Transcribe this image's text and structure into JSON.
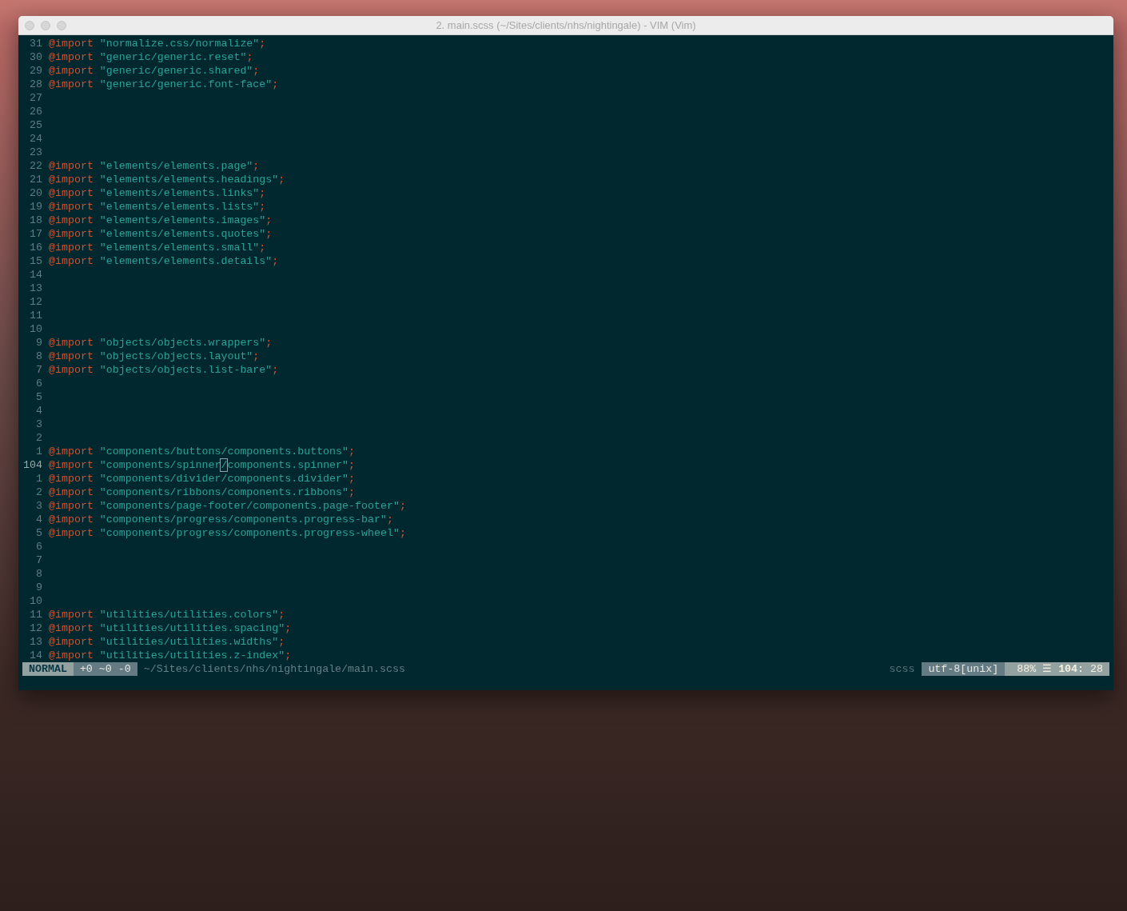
{
  "window": {
    "title": "2. main.scss (~/Sites/clients/nhs/nightingale) - VIM (Vim)"
  },
  "lines": [
    {
      "number": "31",
      "keyword": "@import",
      "string": "\"normalize.css/normalize\"",
      "end": ";",
      "current": false
    },
    {
      "number": "30",
      "keyword": "@import",
      "string": "\"generic/generic.reset\"",
      "end": ";",
      "current": false
    },
    {
      "number": "29",
      "keyword": "@import",
      "string": "\"generic/generic.shared\"",
      "end": ";",
      "current": false
    },
    {
      "number": "28",
      "keyword": "@import",
      "string": "\"generic/generic.font-face\"",
      "end": ";",
      "current": false
    },
    {
      "number": "27",
      "current": false
    },
    {
      "number": "26",
      "current": false
    },
    {
      "number": "25",
      "current": false
    },
    {
      "number": "24",
      "current": false
    },
    {
      "number": "23",
      "current": false
    },
    {
      "number": "22",
      "keyword": "@import",
      "string": "\"elements/elements.page\"",
      "end": ";",
      "current": false
    },
    {
      "number": "21",
      "keyword": "@import",
      "string": "\"elements/elements.headings\"",
      "end": ";",
      "current": false
    },
    {
      "number": "20",
      "keyword": "@import",
      "string": "\"elements/elements.links\"",
      "end": ";",
      "current": false
    },
    {
      "number": "19",
      "keyword": "@import",
      "string": "\"elements/elements.lists\"",
      "end": ";",
      "current": false
    },
    {
      "number": "18",
      "keyword": "@import",
      "string": "\"elements/elements.images\"",
      "end": ";",
      "current": false
    },
    {
      "number": "17",
      "keyword": "@import",
      "string": "\"elements/elements.quotes\"",
      "end": ";",
      "current": false
    },
    {
      "number": "16",
      "keyword": "@import",
      "string": "\"elements/elements.small\"",
      "end": ";",
      "current": false
    },
    {
      "number": "15",
      "keyword": "@import",
      "string": "\"elements/elements.details\"",
      "end": ";",
      "current": false
    },
    {
      "number": "14",
      "current": false
    },
    {
      "number": "13",
      "current": false
    },
    {
      "number": "12",
      "current": false
    },
    {
      "number": "11",
      "current": false
    },
    {
      "number": "10",
      "current": false
    },
    {
      "number": "9",
      "keyword": "@import",
      "string": "\"objects/objects.wrappers\"",
      "end": ";",
      "current": false
    },
    {
      "number": "8",
      "keyword": "@import",
      "string": "\"objects/objects.layout\"",
      "end": ";",
      "current": false
    },
    {
      "number": "7",
      "keyword": "@import",
      "string": "\"objects/objects.list-bare\"",
      "end": ";",
      "current": false
    },
    {
      "number": "6",
      "current": false
    },
    {
      "number": "5",
      "current": false
    },
    {
      "number": "4",
      "current": false
    },
    {
      "number": "3",
      "current": false
    },
    {
      "number": "2",
      "current": false
    },
    {
      "number": "1",
      "keyword": "@import",
      "string": "\"components/buttons/components.buttons\"",
      "end": ";",
      "current": false
    },
    {
      "number": "104",
      "keyword": "@import",
      "string": "\"components/spinner",
      "cursor_char": "/",
      "string_rest": "components.spinner\"",
      "end": ";",
      "current": true
    },
    {
      "number": "1",
      "keyword": "@import",
      "string": "\"components/divider/components.divider\"",
      "end": ";",
      "current": false
    },
    {
      "number": "2",
      "keyword": "@import",
      "string": "\"components/ribbons/components.ribbons\"",
      "end": ";",
      "current": false
    },
    {
      "number": "3",
      "keyword": "@import",
      "string": "\"components/page-footer/components.page-footer\"",
      "end": ";",
      "current": false
    },
    {
      "number": "4",
      "keyword": "@import",
      "string": "\"components/progress/components.progress-bar\"",
      "end": ";",
      "current": false
    },
    {
      "number": "5",
      "keyword": "@import",
      "string": "\"components/progress/components.progress-wheel\"",
      "end": ";",
      "current": false
    },
    {
      "number": "6",
      "current": false
    },
    {
      "number": "7",
      "current": false
    },
    {
      "number": "8",
      "current": false
    },
    {
      "number": "9",
      "current": false
    },
    {
      "number": "10",
      "current": false
    },
    {
      "number": "11",
      "keyword": "@import",
      "string": "\"utilities/utilities.colors\"",
      "end": ";",
      "current": false
    },
    {
      "number": "12",
      "keyword": "@import",
      "string": "\"utilities/utilities.spacing\"",
      "end": ";",
      "current": false
    },
    {
      "number": "13",
      "keyword": "@import",
      "string": "\"utilities/utilities.widths\"",
      "end": ";",
      "current": false
    },
    {
      "number": "14",
      "keyword": "@import",
      "string": "\"utilities/utilities.z-index\"",
      "end": ";",
      "current": false
    }
  ],
  "status_bar": {
    "mode": "NORMAL",
    "diff": "+0 ~0 -0",
    "file_path": "~/Sites/clients/nhs/nightingale/main.scss",
    "filetype": "scss",
    "encoding": "utf-8[unix]",
    "percent": "88%",
    "line_icon": "☰",
    "line": "104:",
    "column": "28"
  }
}
